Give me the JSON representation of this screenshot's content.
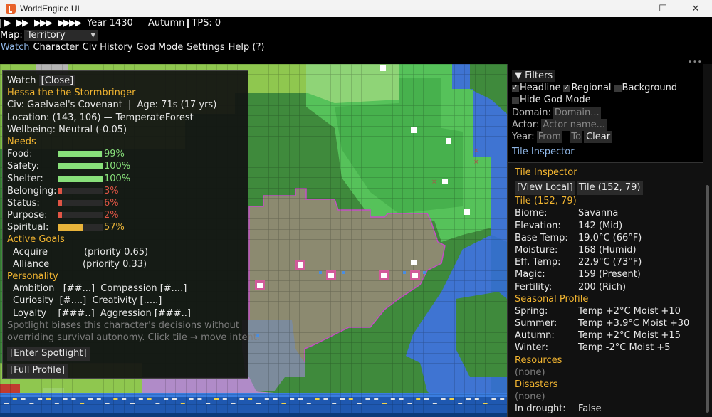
{
  "window": {
    "title": "WorldEngine.UI",
    "minimize": "—",
    "maximize": "☐",
    "close": "✕"
  },
  "toolbar": {
    "speed_buttons": [
      "▶",
      "▶▶",
      "▶▶▶",
      "▶▶▶▶"
    ],
    "date": "Year 1430 — Autumn",
    "tps": "TPS: 0",
    "map_label": "Map:",
    "map_value": "Territory"
  },
  "menu": [
    "Watch",
    "Character",
    "Civ History",
    "God Mode",
    "Settings",
    "Help (?)"
  ],
  "watch": {
    "title": "Watch",
    "close": "[Close]",
    "name": "Hessa the the Stormbringer",
    "civ": "Civ: Gaelvael's Covenant",
    "age": "Age: 71s  (17 yrs)",
    "location": "Location: (143, 106) — TemperateForest",
    "wellbeing": "Wellbeing: Neutral (-0.05)",
    "needs_header": "Needs",
    "needs": [
      {
        "label": "Food:",
        "value": "99%",
        "fill": 0.99,
        "color": "#88e07a"
      },
      {
        "label": "Safety:",
        "value": "100%",
        "fill": 1.0,
        "color": "#88e07a"
      },
      {
        "label": "Shelter:",
        "value": "100%",
        "fill": 1.0,
        "color": "#88e07a"
      },
      {
        "label": "Belonging:",
        "value": "3%",
        "fill": 0.03,
        "color": "#e05545"
      },
      {
        "label": "Status:",
        "value": "6%",
        "fill": 0.06,
        "color": "#e05545"
      },
      {
        "label": "Purpose:",
        "value": "2%",
        "fill": 0.02,
        "color": "#e05545"
      },
      {
        "label": "Spiritual:",
        "value": "57%",
        "fill": 0.57,
        "color": "#e8b33a"
      }
    ],
    "goals_header": "Active Goals",
    "goals": [
      {
        "name": "Acquire",
        "priority": "(priority 0.65)"
      },
      {
        "name": "Alliance",
        "priority": "(priority 0.33)"
      }
    ],
    "personality_header": "Personality",
    "personality_lines": [
      "Ambition   [##...]  Compassion [#....]",
      "Curiosity  [#....]  Creativity [.....]",
      "Loyalty    [###..]  Aggression [###..]"
    ],
    "hint_line1": "Spotlight biases this character's decisions without",
    "hint_line2": "overriding survival autonomy. Click tile → move intent.",
    "spotlight_button": "[Enter Spotlight]",
    "profile_button": "[Full Profile]"
  },
  "filters": {
    "header": "▼ Filters",
    "headline": "Headline",
    "regional": "Regional",
    "background": "Background",
    "hide_god_mode": "Hide God Mode",
    "domain_label": "Domain:",
    "domain_placeholder": "Domain...",
    "actor_label": "Actor:",
    "actor_placeholder": "Actor name...",
    "year_label": "Year:",
    "year_from": "From",
    "year_dash": "–",
    "year_to": "To",
    "clear": "Clear",
    "tab": "Tile Inspector",
    "headline_checked": true,
    "regional_checked": true,
    "background_checked": false,
    "hide_god_mode_checked": false
  },
  "inspector": {
    "title": "Tile Inspector",
    "view_local": "[View Local]",
    "tile_coord": "Tile (152, 79)",
    "tile_header": "Tile (152, 79)",
    "props": [
      {
        "key": "Biome:",
        "value": "Savanna"
      },
      {
        "key": "Elevation:",
        "value": "142 (Mid)"
      },
      {
        "key": "Base Temp:",
        "value": "19.0°C (66°F)"
      },
      {
        "key": "Moisture:",
        "value": "168 (Humid)"
      },
      {
        "key": "Eff. Temp:",
        "value": "22.9°C (73°F)"
      },
      {
        "key": "Magic:",
        "value": "159 (Present)"
      },
      {
        "key": "Fertility:",
        "value": "200 (Rich)"
      }
    ],
    "seasonal_header": "Seasonal Profile",
    "seasons": [
      {
        "key": "Spring:",
        "value": "Temp +2°C  Moist +10"
      },
      {
        "key": "Summer:",
        "value": "Temp +3.9°C  Moist +30"
      },
      {
        "key": "Autumn:",
        "value": "Temp +2°C  Moist +15"
      },
      {
        "key": "Winter:",
        "value": "Temp -2°C  Moist +5"
      }
    ],
    "resources_header": "Resources",
    "resources_value": "(none)",
    "disasters_header": "Disasters",
    "disasters_value": "(none)",
    "drought_key": "In drought:",
    "drought_value": "False"
  }
}
